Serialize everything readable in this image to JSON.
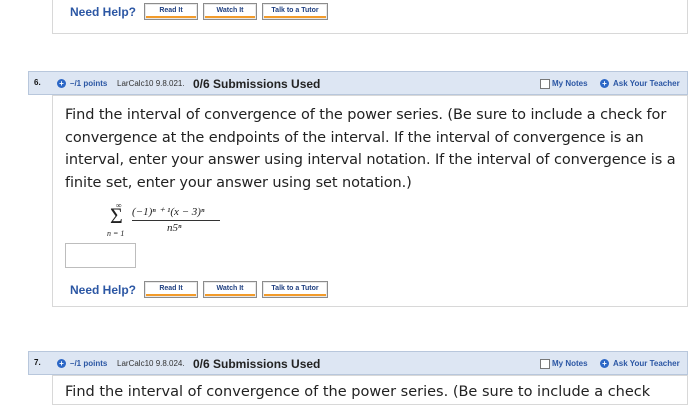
{
  "top_help": {
    "label": "Need Help?",
    "buttons": [
      "Read It",
      "Watch It",
      "Talk to a Tutor"
    ]
  },
  "question6": {
    "number": "6.",
    "points": "–/1 points",
    "source": "LarCalc10 9.8.021.",
    "submissions": "0/6 Submissions Used",
    "my_notes": "My Notes",
    "ask_teacher": "Ask Your Teacher",
    "text": "Find the interval of convergence of the power series. (Be sure to include a check for convergence at the endpoints of the interval. If the interval of convergence is an interval, enter your answer using interval notation. If the interval of convergence is a finite set, enter your answer using set notation.)",
    "series": {
      "upper": "∞",
      "sigma": "Σ",
      "lower": "n = 1",
      "numerator": "(−1)ⁿ ⁺ ¹(x − 3)ⁿ",
      "denominator": "n5ⁿ"
    },
    "answer_value": "",
    "help_label": "Need Help?",
    "help_buttons": [
      "Read It",
      "Watch It",
      "Talk to a Tutor"
    ]
  },
  "question7": {
    "number": "7.",
    "points": "–/1 points",
    "source": "LarCalc10 9.8.024.",
    "submissions": "0/6 Submissions Used",
    "my_notes": "My Notes",
    "ask_teacher": "Ask Your Teacher",
    "text_partial": "Find the interval of convergence of the power series. (Be sure to include a check"
  },
  "colors": {
    "bar_bg": "#dde6f3",
    "link_blue": "#2c57a4",
    "button_accent": "#f29b2a"
  }
}
